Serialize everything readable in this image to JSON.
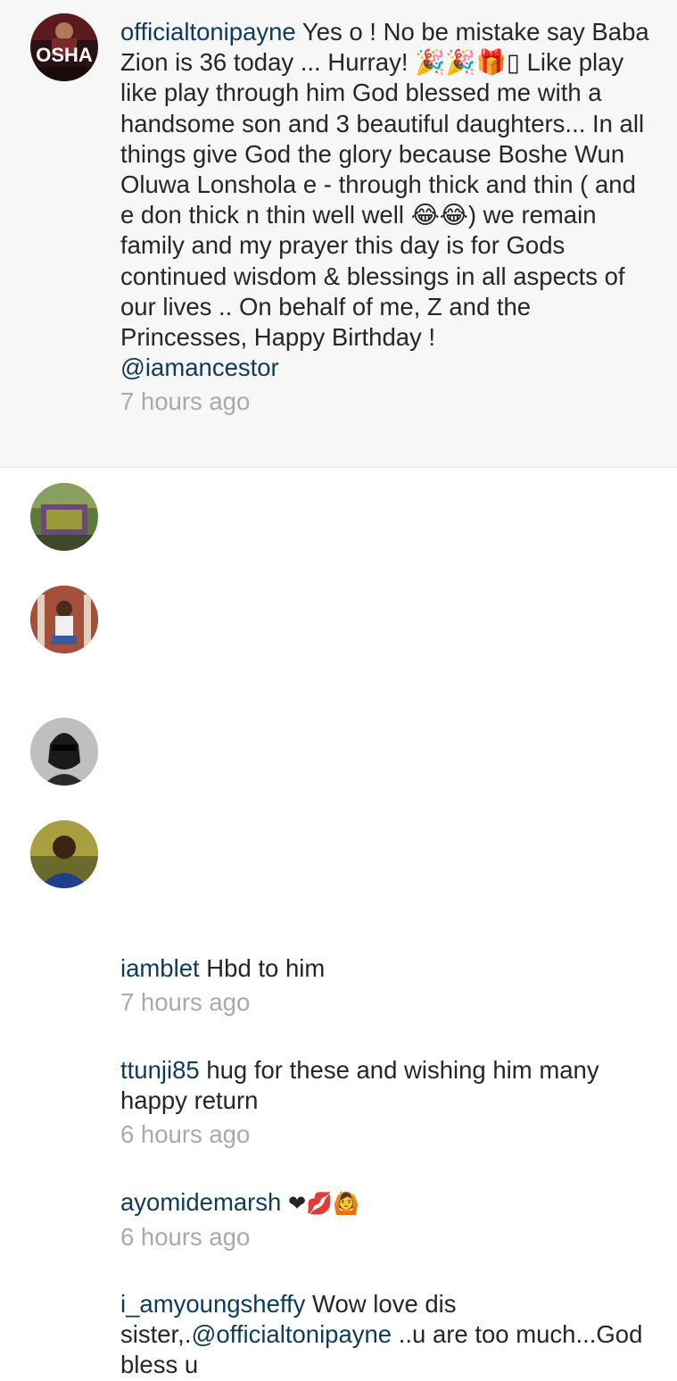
{
  "caption": {
    "username": "officialtonipayne",
    "text_before_mention": "Yes o ! No be mistake say Baba Zion is 36 today ... Hurray! 🎉🎉🎁▯ Like play like play through him God blessed me with a handsome son and 3 beautiful daughters... In all things give God the glory because Boshe Wun Oluwa Lonshola e - through thick and thin ( and e don thick n thin well well 😂😂) we remain family and my prayer this day is for Gods continued wisdom & blessings in all aspects of our lives .. On behalf of me, Z and the Princesses, Happy Birthday !",
    "mention": "@iamancestor",
    "time": "7 hours ago",
    "avatar_text": "OSHA"
  },
  "comments": [
    {
      "username": "iamblet",
      "text": "Hbd to him",
      "time": "7 hours ago"
    },
    {
      "username": "ttunji85",
      "text": "hug for these and wishing him many happy return",
      "time": "6 hours ago"
    },
    {
      "username": "ayomidemarsh",
      "text": "❤💋🙆",
      "time": "6 hours ago"
    },
    {
      "username": "i_amyoungsheffy",
      "text": "Wow love dis sister,.",
      "mention": "@officialtonipayne",
      "text_after": "..u are too much...God bless u"
    }
  ],
  "colors": {
    "username": "#0e3b5c",
    "timestamp": "#a9a9a9",
    "caption_bg": "#f7f7f7"
  }
}
